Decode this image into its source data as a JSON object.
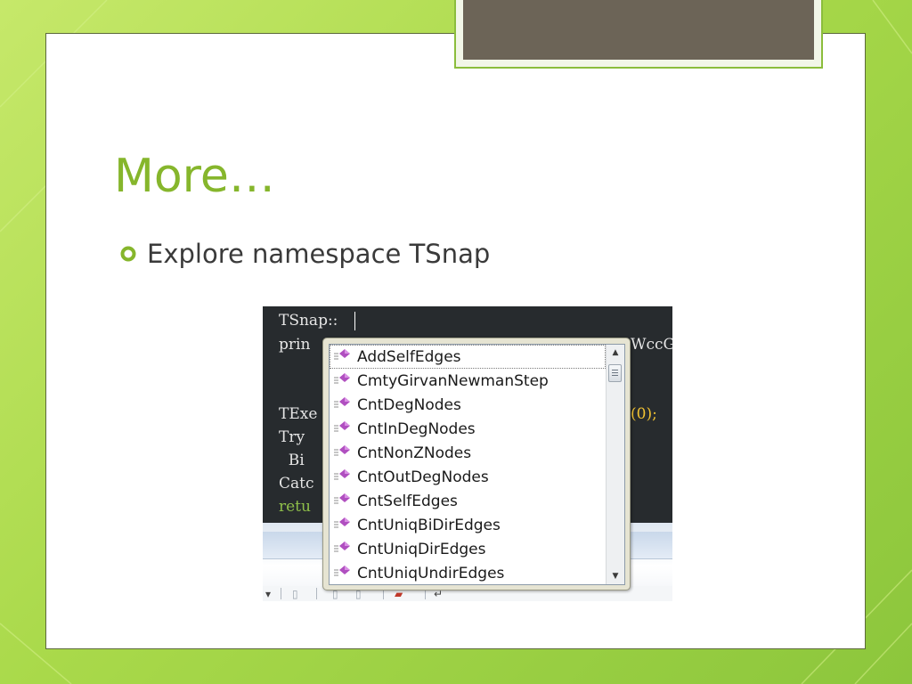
{
  "slide": {
    "title": "More…",
    "bullet": "Explore namespace TSnap"
  },
  "editor": {
    "lines": [
      {
        "text": "TSnap::",
        "style": "plain"
      },
      {
        "text": "prin",
        "style": "plain"
      },
      {
        "text": "TExe",
        "style": "plain"
      },
      {
        "text": "Try",
        "style": "plain"
      },
      {
        "text": "  Bi",
        "style": "plain"
      },
      {
        "text": "Catc",
        "style": "plain"
      },
      {
        "text": "retu",
        "style": "green"
      }
    ],
    "right_fragments": {
      "wcc": "WccG-",
      "zero_call": "(0);"
    }
  },
  "intellisense": {
    "selected_index": 0,
    "items": [
      "AddSelfEdges",
      "CmtyGirvanNewmanStep",
      "CntDegNodes",
      "CntInDegNodes",
      "CntNonZNodes",
      "CntOutDegNodes",
      "CntSelfEdges",
      "CntUniqBiDirEdges",
      "CntUniqDirEdges",
      "CntUniqUndirEdges"
    ],
    "item_icon": "method-icon",
    "scroll_up": "▲",
    "scroll_down": "▼"
  },
  "colors": {
    "title_green": "#86b62c",
    "bullet_green": "#86b62c",
    "editor_bg": "#272b2e",
    "method_icon": "#b04fc0"
  }
}
